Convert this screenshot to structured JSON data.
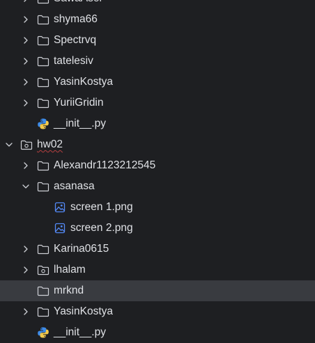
{
  "project_tree": {
    "items": [
      {
        "label": "SawaAsel",
        "icon": "folder-icon",
        "expander": "collapsed",
        "level": 1
      },
      {
        "label": "shyma66",
        "icon": "folder-icon",
        "expander": "collapsed",
        "level": 1
      },
      {
        "label": "Spectrvq",
        "icon": "folder-icon",
        "expander": "collapsed",
        "level": 1
      },
      {
        "label": "tatelesiv",
        "icon": "folder-icon",
        "expander": "collapsed",
        "level": 1
      },
      {
        "label": "YasinKostya",
        "icon": "folder-icon",
        "expander": "collapsed",
        "level": 1
      },
      {
        "label": "YuriiGridin",
        "icon": "folder-icon",
        "expander": "collapsed",
        "level": 1
      },
      {
        "label": "__init__.py",
        "icon": "python-file-icon",
        "expander": "none",
        "level": 1
      },
      {
        "label": "hw02",
        "icon": "package-folder-icon",
        "expander": "expanded",
        "level": 0,
        "spell_error": true
      },
      {
        "label": "Alexandr1123212545",
        "icon": "folder-icon",
        "expander": "collapsed",
        "level": 1
      },
      {
        "label": "asanasa",
        "icon": "folder-icon",
        "expander": "expanded",
        "level": 1
      },
      {
        "label": "screen 1.png",
        "icon": "image-file-icon",
        "expander": "none",
        "level": 2
      },
      {
        "label": "screen 2.png",
        "icon": "image-file-icon",
        "expander": "none",
        "level": 2
      },
      {
        "label": "Karina0615",
        "icon": "folder-icon",
        "expander": "collapsed",
        "level": 1
      },
      {
        "label": "lhalam",
        "icon": "package-folder-icon",
        "expander": "collapsed",
        "level": 1
      },
      {
        "label": "mrknd",
        "icon": "folder-icon",
        "expander": "none",
        "level": 1,
        "selected": true
      },
      {
        "label": "YasinKostya",
        "icon": "folder-icon",
        "expander": "collapsed",
        "level": 1
      },
      {
        "label": "__init__.py",
        "icon": "python-file-icon",
        "expander": "none",
        "level": 1
      }
    ]
  },
  "colors": {
    "background": "#1e1f22",
    "selection": "#393b40",
    "text": "#dfe1e5",
    "icon_stroke": "#ced0d6",
    "image_icon": "#548af7",
    "python_blue": "#3d8be9",
    "python_yellow": "#f2c94c",
    "spell_underline": "#b33f3f"
  }
}
